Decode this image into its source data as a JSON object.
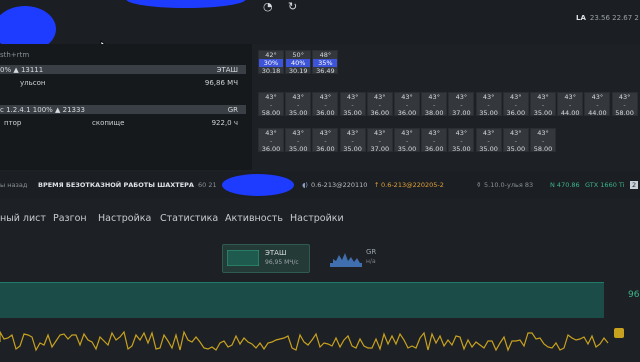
{
  "topbar": {
    "la_label": "LA",
    "la_values": "23.56 22.67 2",
    "icons": [
      "clock-icon",
      "refresh-icon"
    ]
  },
  "left_panel": {
    "card1": {
      "title": "sth+rtm",
      "bar": "0%  ▲ 13111",
      "bar_status": "ЭТАШ",
      "name": "ульсон",
      "hashrate": "96,86 МЧ"
    },
    "card2": {
      "bar": "с 1.2.4.1  100%  ▲ 21333",
      "bar_status": "GR",
      "name_left": "птор",
      "name_mid": "скопище",
      "hashrate": "922,0 ч"
    }
  },
  "gpu_grid": {
    "row1": [
      {
        "temp": "42°",
        "fan": "30%",
        "value": "30.18",
        "selected": true
      },
      {
        "temp": "50°",
        "fan": "40%",
        "value": "30.19",
        "selected": true
      },
      {
        "temp": "48°",
        "fan": "35%",
        "value": "36.49",
        "selected": true
      }
    ],
    "row2": [
      {
        "temp": "43°",
        "fan": "-",
        "value": "58.00"
      },
      {
        "temp": "43°",
        "fan": "-",
        "value": "35.00"
      },
      {
        "temp": "43°",
        "fan": "-",
        "value": "36.00"
      },
      {
        "temp": "43°",
        "fan": "-",
        "value": "35.00"
      },
      {
        "temp": "43°",
        "fan": "-",
        "value": "36.00"
      },
      {
        "temp": "43°",
        "fan": "-",
        "value": "36.00"
      },
      {
        "temp": "43°",
        "fan": "-",
        "value": "38.00"
      },
      {
        "temp": "43°",
        "fan": "-",
        "value": "37.00"
      },
      {
        "temp": "43°",
        "fan": "-",
        "value": "35.00"
      },
      {
        "temp": "43°",
        "fan": "-",
        "value": "36.00"
      },
      {
        "temp": "43°",
        "fan": "-",
        "value": "35.00"
      },
      {
        "temp": "43°",
        "fan": "-",
        "value": "44.00"
      },
      {
        "temp": "43°",
        "fan": "-",
        "value": "44.00"
      },
      {
        "temp": "43°",
        "fan": "-",
        "value": "58.00"
      }
    ],
    "row3": [
      {
        "temp": "43°",
        "fan": "-",
        "value": "36.00"
      },
      {
        "temp": "43°",
        "fan": "-",
        "value": "35.00"
      },
      {
        "temp": "43°",
        "fan": "-",
        "value": "36.00"
      },
      {
        "temp": "43°",
        "fan": "-",
        "value": "35.00"
      },
      {
        "temp": "43°",
        "fan": "-",
        "value": "37.00"
      },
      {
        "temp": "43°",
        "fan": "-",
        "value": "35.00"
      },
      {
        "temp": "43°",
        "fan": "-",
        "value": "36.00"
      },
      {
        "temp": "43°",
        "fan": "-",
        "value": "35.00"
      },
      {
        "temp": "43°",
        "fan": "-",
        "value": "35.00"
      },
      {
        "temp": "43°",
        "fan": "-",
        "value": "35.00"
      },
      {
        "temp": "43°",
        "fan": "-",
        "value": "58.00"
      }
    ]
  },
  "status": {
    "ago": "ы назад",
    "uptime_label": "ВРЕМЯ БЕЗОТКАЗНОЙ РАБОТЫ ШАХТЕРА",
    "uptime_value": "60 21",
    "version1": "0.6-213@220110",
    "version2": "0.6-213@220205-2",
    "kernel": "5.10.0-улья 83",
    "nvidia": "N 470.86",
    "gpu_model": "GTX 1660 Ti",
    "gpu_count": "2"
  },
  "tabs": [
    "ный лист",
    "Разгон",
    "Настройка",
    "Статистика",
    "Активность",
    "Настройки"
  ],
  "algo_cards": [
    {
      "name": "ЭТАШ",
      "value": "96,95 МЧ/с"
    },
    {
      "name": "GR",
      "value": "н/а"
    }
  ],
  "charts": {
    "hashrate_label": "96",
    "colors": {
      "teal_fill": "#1b4c48",
      "teal_line": "#1f7a6a",
      "yellow_line": "#c8a21e",
      "accent_green": "#3bb58a",
      "select_blue": "#3d54d8"
    }
  }
}
